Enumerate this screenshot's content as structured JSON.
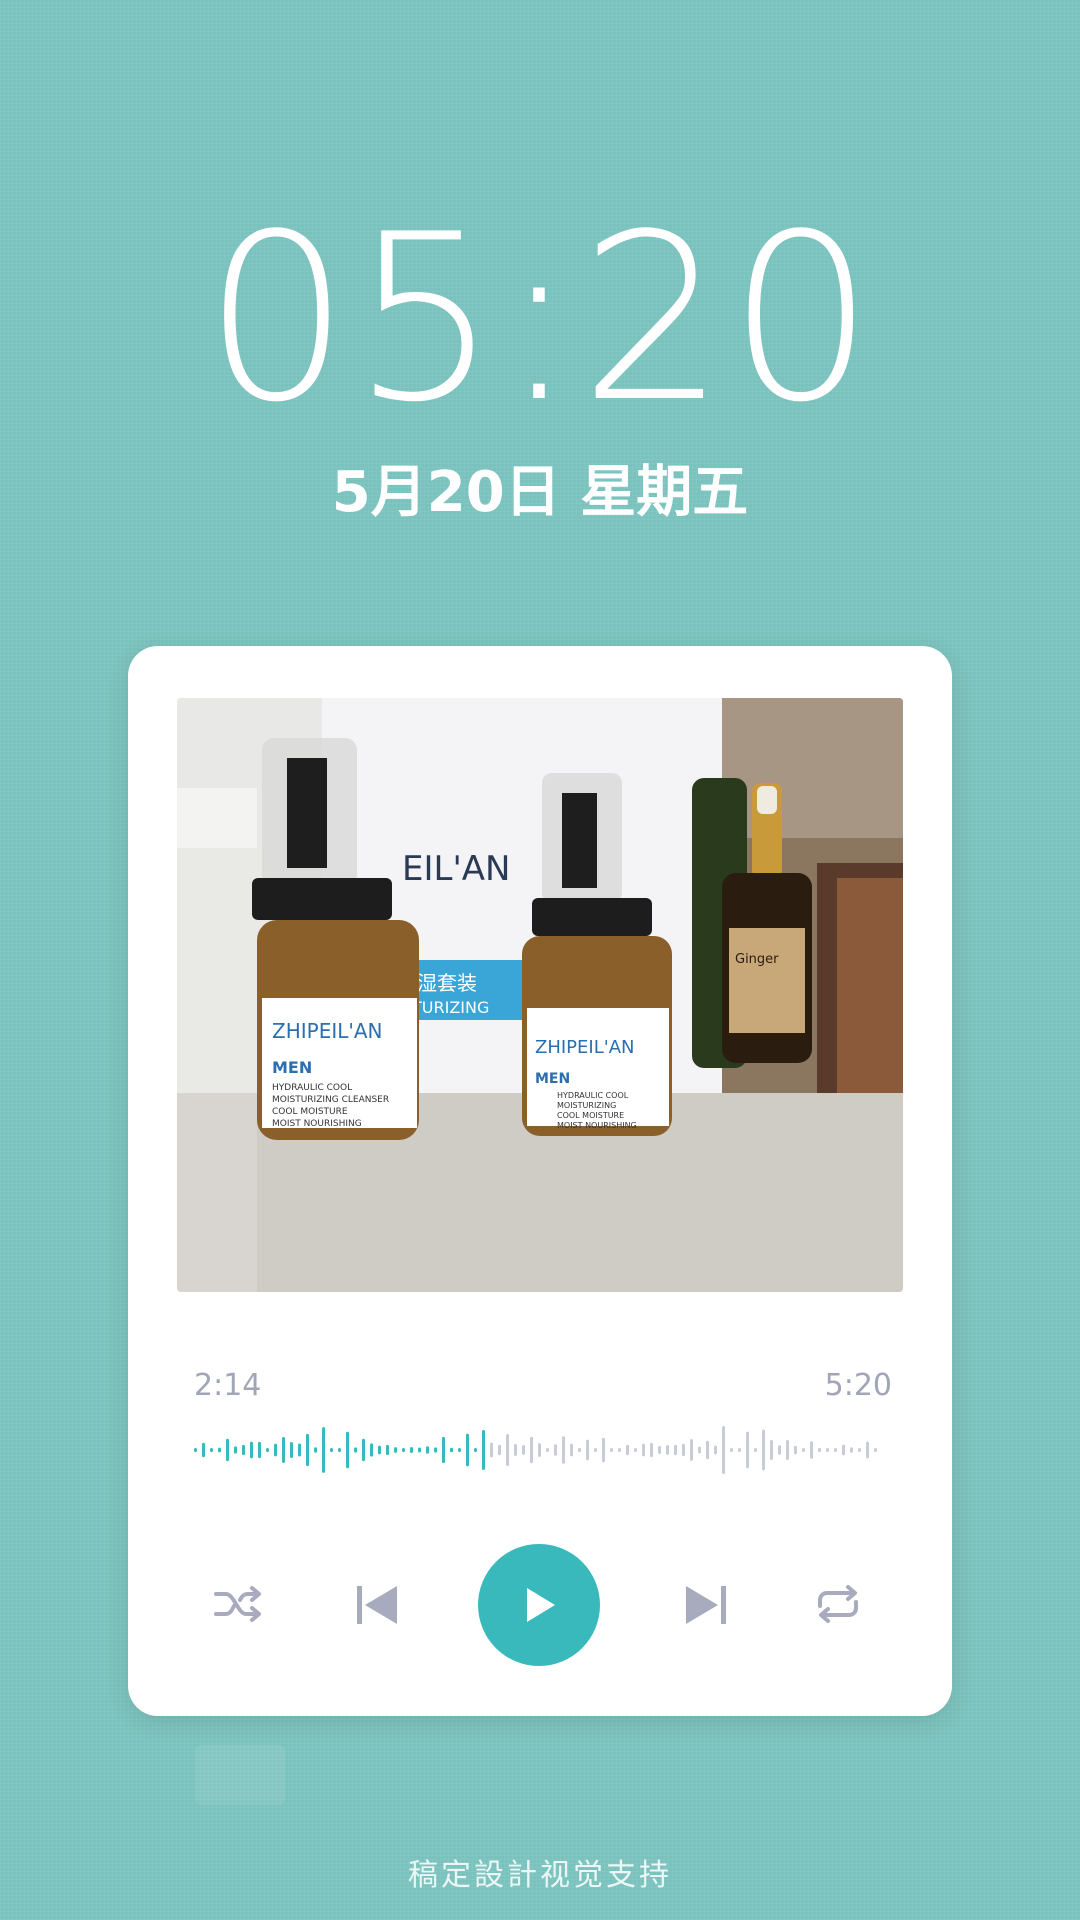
{
  "lockscreen": {
    "time": "05:20",
    "date": "5月20日 星期五"
  },
  "player": {
    "elapsed": "2:14",
    "duration": "5:20",
    "progress": 0.42,
    "accent_color": "#39b9bb",
    "inactive_color": "#c8ccd6",
    "icons": {
      "shuffle": "shuffle-icon",
      "previous": "skip-previous-icon",
      "play": "play-icon",
      "next": "skip-next-icon",
      "repeat": "repeat-icon"
    },
    "album_art": {
      "brand_text": "ZHIPEIL'AN",
      "box_text": "EIL'AN",
      "box_band": "湿套装",
      "box_band_sub": "TURIZING",
      "bottle_men": "MEN",
      "bottle_left_lines": [
        "HYDRAULIC COOL",
        "MOISTURIZING CLEANSER",
        "COOL MOISTURE",
        "MOIST NOURISHING"
      ],
      "bottle_right_lines": [
        "HYDRAULIC COOL",
        "MOISTURIZING",
        "COOL MOISTURE",
        "MOIST NOURISHING"
      ],
      "small_bottle_text": "Ginger"
    }
  },
  "footer": {
    "text": "稿定設計视觉支持"
  }
}
